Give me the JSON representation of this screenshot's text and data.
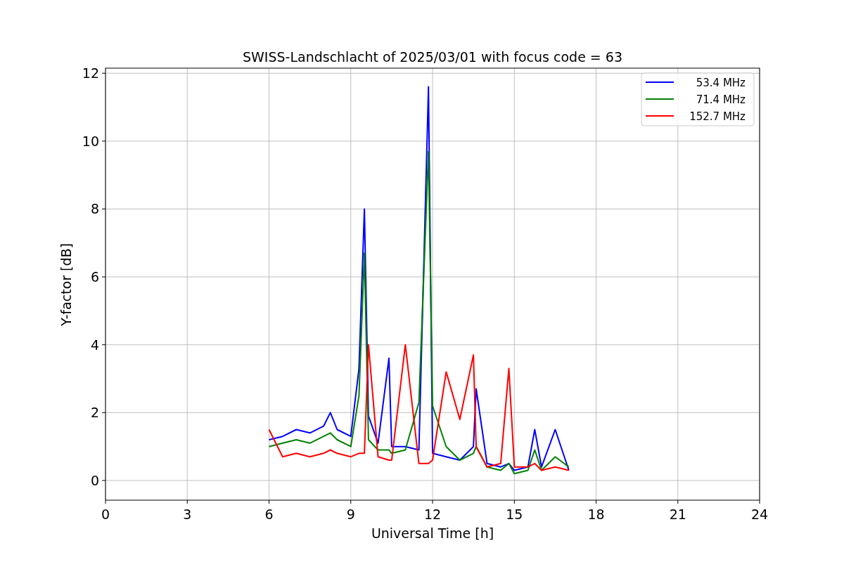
{
  "chart_data": {
    "type": "line",
    "title": "SWISS-Landschlacht of 2025/03/01 with focus code = 63",
    "xlabel": "Universal Time [h]",
    "ylabel": "Y-factor [dB]",
    "x": [
      6,
      6.5,
      7,
      7.5,
      8,
      8.25,
      8.5,
      9,
      9.3,
      9.5,
      9.65,
      10,
      10.4,
      10.5,
      11,
      11.5,
      11.85,
      12,
      12.5,
      13,
      13.5,
      13.6,
      14,
      14.5,
      14.8,
      15,
      15.5,
      15.75,
      16,
      16.5,
      17
    ],
    "series": [
      {
        "name": "53.4 MHz",
        "color": "#0000ff",
        "values": [
          1.2,
          1.3,
          1.5,
          1.4,
          1.6,
          2.0,
          1.5,
          1.3,
          3.3,
          8.0,
          1.9,
          1.1,
          3.6,
          1.0,
          1.0,
          0.9,
          11.6,
          0.8,
          0.7,
          0.6,
          1.0,
          2.7,
          0.5,
          0.4,
          0.5,
          0.3,
          0.4,
          1.5,
          0.4,
          1.5,
          0.3
        ]
      },
      {
        "name": "71.4 MHz",
        "color": "#008000",
        "values": [
          1.0,
          1.1,
          1.2,
          1.1,
          1.3,
          1.4,
          1.2,
          1.0,
          2.5,
          6.7,
          1.2,
          0.9,
          0.9,
          0.8,
          0.9,
          2.3,
          9.7,
          2.2,
          1.0,
          0.6,
          0.8,
          1.0,
          0.4,
          0.3,
          0.5,
          0.2,
          0.3,
          0.9,
          0.3,
          0.7,
          0.4
        ]
      },
      {
        "name": "152.7 MHz",
        "color": "#ff0000",
        "values": [
          1.5,
          0.7,
          0.8,
          0.7,
          0.8,
          0.9,
          0.8,
          0.7,
          0.8,
          0.8,
          4.0,
          0.7,
          0.6,
          0.6,
          4.0,
          0.5,
          0.5,
          0.6,
          3.2,
          1.8,
          3.7,
          1.0,
          0.4,
          0.5,
          3.3,
          0.4,
          0.4,
          0.5,
          0.3,
          0.4,
          0.3
        ]
      }
    ],
    "xlim": [
      0,
      24
    ],
    "ylim": [
      -0.58,
      12.15
    ],
    "xticks": [
      0,
      3,
      6,
      9,
      12,
      15,
      18,
      21,
      24
    ],
    "yticks": [
      0,
      2,
      4,
      6,
      8,
      10,
      12
    ],
    "grid": true,
    "legend": true
  }
}
